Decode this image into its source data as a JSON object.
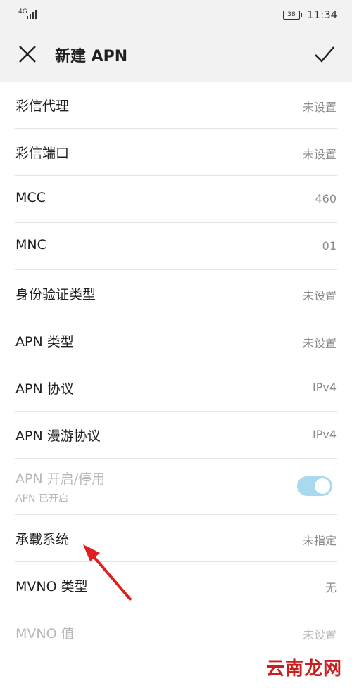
{
  "status_bar": {
    "network": "4G",
    "battery": "38",
    "time": "11:34"
  },
  "toolbar": {
    "title": "新建 APN",
    "close_icon": "close-icon",
    "confirm_icon": "check-icon"
  },
  "rows": [
    {
      "label": "彩信代理",
      "value": "未设置"
    },
    {
      "label": "彩信端口",
      "value": "未设置"
    },
    {
      "label": "MCC",
      "value": "460"
    },
    {
      "label": "MNC",
      "value": "01"
    },
    {
      "label": "身份验证类型",
      "value": "未设置"
    },
    {
      "label": "APN 类型",
      "value": "未设置"
    },
    {
      "label": "APN 协议",
      "value": "IPv4"
    },
    {
      "label": "APN 漫游协议",
      "value": "IPv4"
    }
  ],
  "toggle_row": {
    "label": "APN 开启/停用",
    "sublabel": "APN 已开启",
    "enabled": true
  },
  "rows_after": [
    {
      "label": "承载系统",
      "value": "未指定"
    },
    {
      "label": "MVNO 类型",
      "value": "无"
    },
    {
      "label": "MVNO 值",
      "value": "未设置"
    }
  ],
  "watermark": "云南龙网",
  "colors": {
    "toggle_track": "#a9d9ef",
    "arrow": "#e11d1d",
    "watermark": "#cc1d1d"
  }
}
